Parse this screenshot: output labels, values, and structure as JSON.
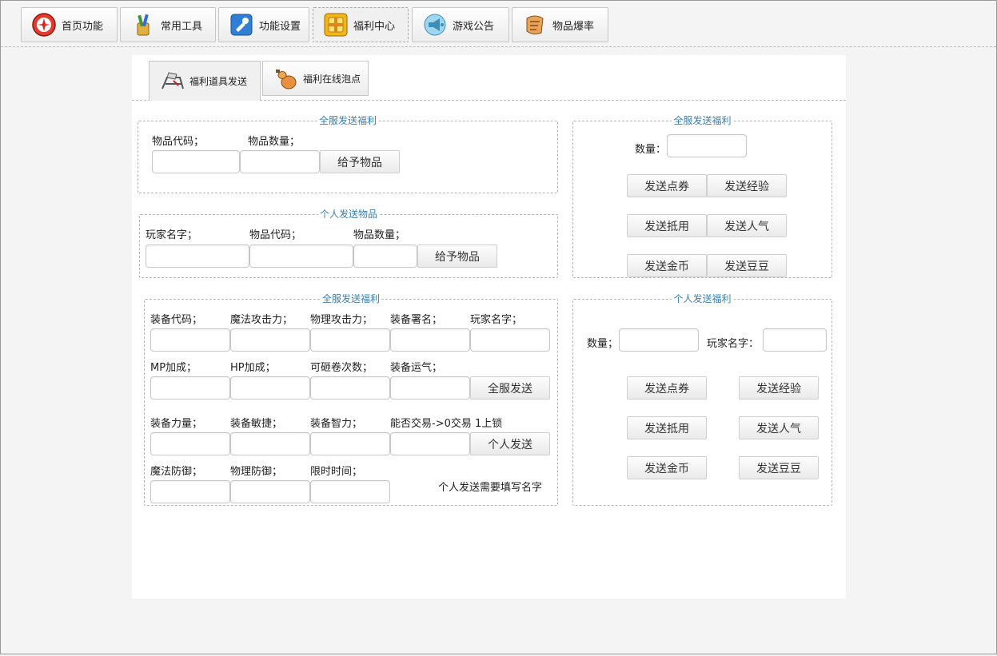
{
  "nav": {
    "tabs": [
      {
        "label": "首页功能",
        "icon": "mushroom-icon"
      },
      {
        "label": "常用工具",
        "icon": "tools-icon"
      },
      {
        "label": "功能设置",
        "icon": "settings-icon"
      },
      {
        "label": "福利中心",
        "icon": "gift-icon"
      },
      {
        "label": "游戏公告",
        "icon": "megaphone-icon"
      },
      {
        "label": "物品爆率",
        "icon": "scroll-icon"
      }
    ],
    "active": "福利中心"
  },
  "subtabs": [
    {
      "label": "福利道具发送",
      "icon": "chair-icon"
    },
    {
      "label": "福利在线泡点",
      "icon": "gourd-icon"
    }
  ],
  "server_item": {
    "legend": "全服发送福利",
    "item_code_label": "物品代码；",
    "item_qty_label": "物品数量；",
    "give_button": "给予物品"
  },
  "personal_item": {
    "legend": "个人发送物品",
    "player_label": "玩家名字；",
    "item_code_label": "物品代码；",
    "item_qty_label": "物品数量；",
    "give_button": "给予物品"
  },
  "equipment": {
    "legend": "全服发送福利",
    "row1": [
      "装备代码；",
      "魔法攻击力；",
      "物理攻击力；",
      "装备署名；",
      "玩家名字；"
    ],
    "row2": [
      "MP加成；",
      "HP加成；",
      "可砸卷次数；",
      "装备运气；"
    ],
    "row3": [
      "装备力量；",
      "装备敏捷；",
      "装备智力；",
      "能否交易->0交易 1上锁"
    ],
    "row4": [
      "魔法防御；",
      "物理防御；",
      "限时时间；"
    ],
    "server_send_button": "全服发送",
    "personal_send_button": "个人发送",
    "note": "个人发送需要填写名字"
  },
  "server_benefit": {
    "legend": "全服发送福利",
    "qty_label": "数量：",
    "buttons": [
      "发送点券",
      "发送经验",
      "发送抵用",
      "发送人气",
      "发送金币",
      "发送豆豆"
    ]
  },
  "personal_benefit": {
    "legend": "个人发送福利",
    "qty_label": "数量；",
    "player_label": "玩家名字：",
    "buttons": [
      "发送点券",
      "发送经验",
      "发送抵用",
      "发送人气",
      "发送金币",
      "发送豆豆"
    ]
  },
  "colors": {
    "legend": "#3b7fb0",
    "border_dashed": "#b4b4b4"
  }
}
